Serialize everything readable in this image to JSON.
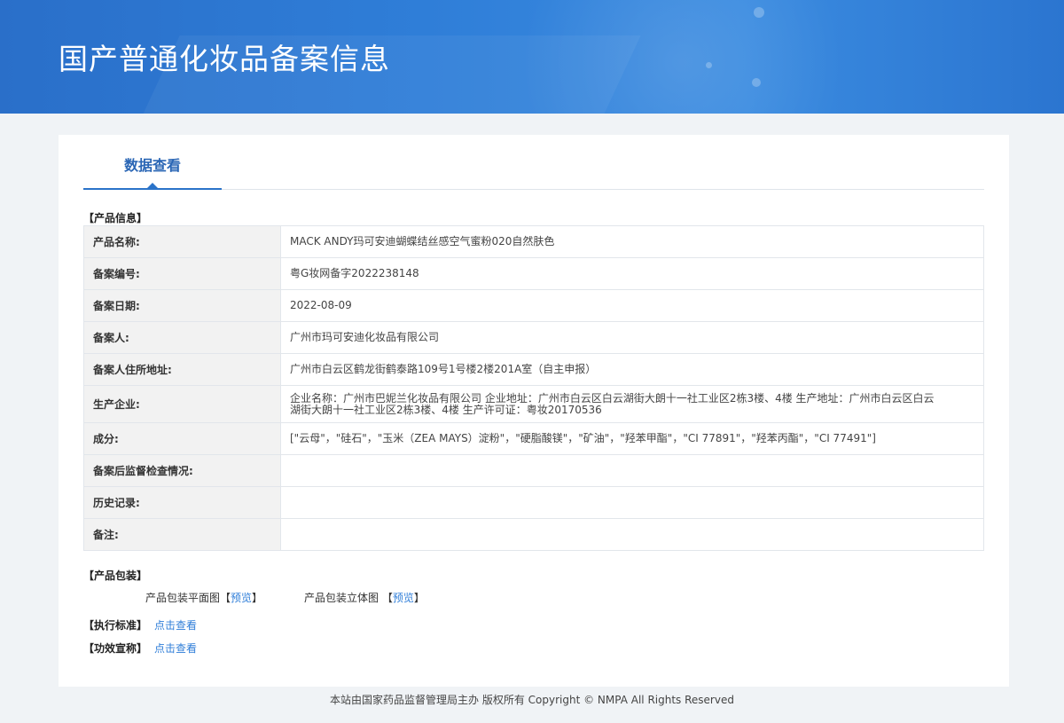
{
  "header": {
    "title": "国产普通化妆品备案信息"
  },
  "tabs": [
    {
      "label": "数据查看",
      "active": true
    }
  ],
  "product_info": {
    "section_title": "【产品信息】",
    "rows": [
      {
        "label": "产品名称:",
        "value": "MACK ANDY玛可安迪蝴蝶结丝感空气蜜粉020自然肤色"
      },
      {
        "label": "备案编号:",
        "value": "粤G妆网备字2022238148"
      },
      {
        "label": "备案日期:",
        "value": "2022-08-09"
      },
      {
        "label": "备案人:",
        "value": "广州市玛可安迪化妆品有限公司"
      },
      {
        "label": "备案人住所地址:",
        "value": "广州市白云区鹤龙街鹤泰路109号1号楼2楼201A室（自主申报）"
      },
      {
        "label": "生产企业:",
        "value": "企业名称：广州市巴妮兰化妆品有限公司 企业地址：广州市白云区白云湖街大朗十一社工业区2栋3楼、4楼 生产地址：广州市白云区白云湖街大朗十一社工业区2栋3楼、4楼 生产许可证：粤妆20170536"
      },
      {
        "label": "成分:",
        "value": "[\"云母\"，\"硅石\"，\"玉米（ZEA MAYS）淀粉\"，\"硬脂酸镁\"，\"矿油\"，\"羟苯甲酯\"，\"CI 77891\"，\"羟苯丙酯\"，\"CI 77491\"]"
      },
      {
        "label": "备案后监督检查情况:",
        "value": ""
      },
      {
        "label": "历史记录:",
        "value": ""
      },
      {
        "label": "备注:",
        "value": ""
      }
    ]
  },
  "packaging": {
    "section_title": "【产品包装】",
    "flat": {
      "label": "产品包装平面图",
      "open": "【",
      "link": "预览",
      "close": "】"
    },
    "solid": {
      "label": "产品包装立体图",
      "open": "【",
      "link": "预览",
      "close": "】"
    }
  },
  "standard": {
    "label": "【执行标准】",
    "link": "点击查看"
  },
  "efficacy": {
    "label": "【功效宣称】",
    "link": "点击查看"
  },
  "footer": {
    "text": "本站由国家药品监督管理局主办 版权所有 Copyright © NMPA All Rights Reserved"
  },
  "colors": {
    "banner": "#2f7ed8",
    "accent": "#2a66b5",
    "link": "#2f7ed8",
    "page_bg": "#f0f3f6"
  }
}
